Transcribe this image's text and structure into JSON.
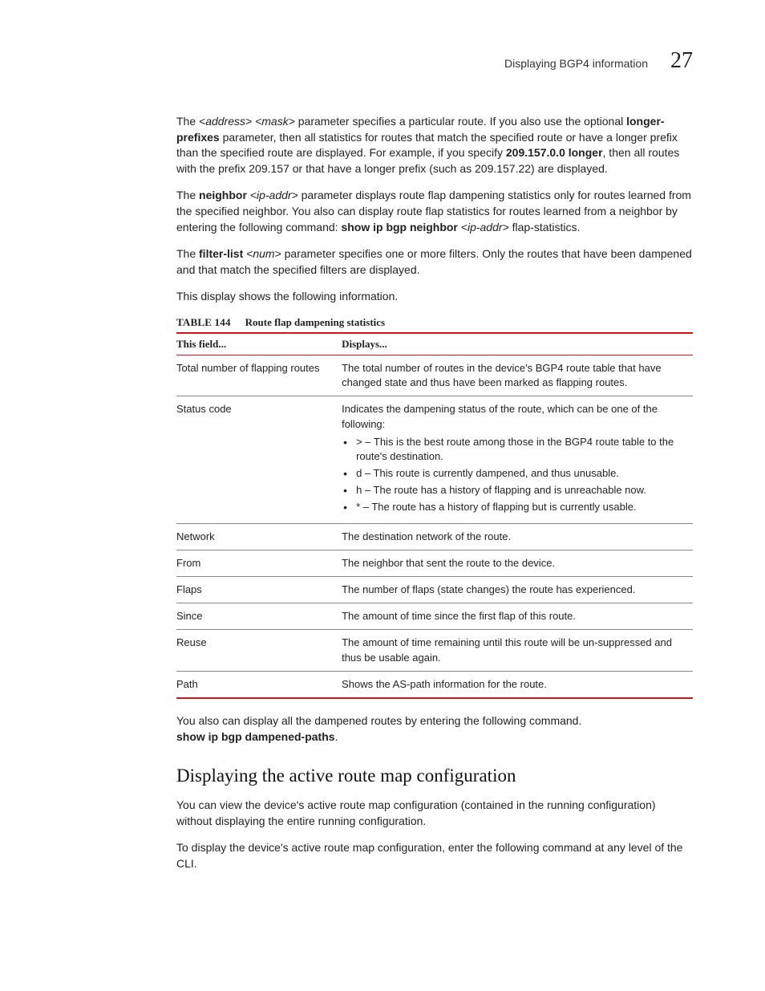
{
  "header": {
    "title": "Displaying BGP4 information",
    "chapter": "27"
  },
  "p1": {
    "t1": "The ",
    "addr": "<address> <mask>",
    "t2": " parameter specifies a particular route.  If you also use the optional ",
    "lp": "longer-prefixes",
    "t3": " parameter, then all statistics for routes that match the specified route or have a longer prefix than the specified route are displayed.  For example, if you specify ",
    "ex": "209.157.0.0 longer",
    "t4": ", then all routes with the prefix 209.157 or that have a longer prefix (such as 209.157.22) are displayed."
  },
  "p2": {
    "t1": "The ",
    "nb": "neighbor",
    "ip1": " <ip-addr>",
    "t2": " parameter displays route flap dampening statistics only for routes learned from the specified neighbor.  You also can display route flap statistics for routes learned from a neighbor by entering the following command:  ",
    "cmd": "show ip bgp neighbor",
    "ip2": " <ip-addr>",
    "fs": " flap-statistics."
  },
  "p3": {
    "t1": "The ",
    "fl": "filter-list",
    "num": " <num>",
    "t2": " parameter specifies one or more filters.  Only the routes that have been dampened and that match the specified filters are displayed."
  },
  "p4": "This display shows the following information.",
  "table": {
    "num": "TABLE 144",
    "title": "Route flap dampening statistics",
    "h1": "This field...",
    "h2": "Displays...",
    "rows": {
      "r0": {
        "f": "Total number of flapping routes",
        "d": "The total number of routes in the device's BGP4 route table that have changed state and thus have been marked as flapping routes."
      },
      "r1": {
        "f": "Status code",
        "intro": "Indicates the dampening status of the route, which can be one of the following:",
        "b0": "> – This is the best route among those in the BGP4 route table to the route's destination.",
        "b1": "d – This route is currently dampened, and thus unusable.",
        "b2": "h – The route has a history of flapping and is unreachable now.",
        "b3": "* – The route has a history of flapping but is currently usable."
      },
      "r2": {
        "f": "Network",
        "d": "The destination network of the route."
      },
      "r3": {
        "f": "From",
        "d": "The neighbor that sent the route to the device."
      },
      "r4": {
        "f": "Flaps",
        "d": "The number of flaps (state changes) the route has experienced."
      },
      "r5": {
        "f": "Since",
        "d": "The amount of time since the first flap of this route."
      },
      "r6": {
        "f": "Reuse",
        "d": "The amount of time remaining until this route will be un-suppressed and thus be usable again."
      },
      "r7": {
        "f": "Path",
        "d": "Shows the AS-path information for the route."
      }
    }
  },
  "p5": {
    "t1": "You also can display all the dampened routes by entering the following command. ",
    "cmd": "show ip bgp dampened-paths",
    "t2": "."
  },
  "section": "Displaying the active route map configuration",
  "p6": "You can view the device's active route map configuration (contained in the running configuration) without displaying the entire running configuration.",
  "p7": "To display the device's active route map configuration, enter the following command at any level of the CLI."
}
